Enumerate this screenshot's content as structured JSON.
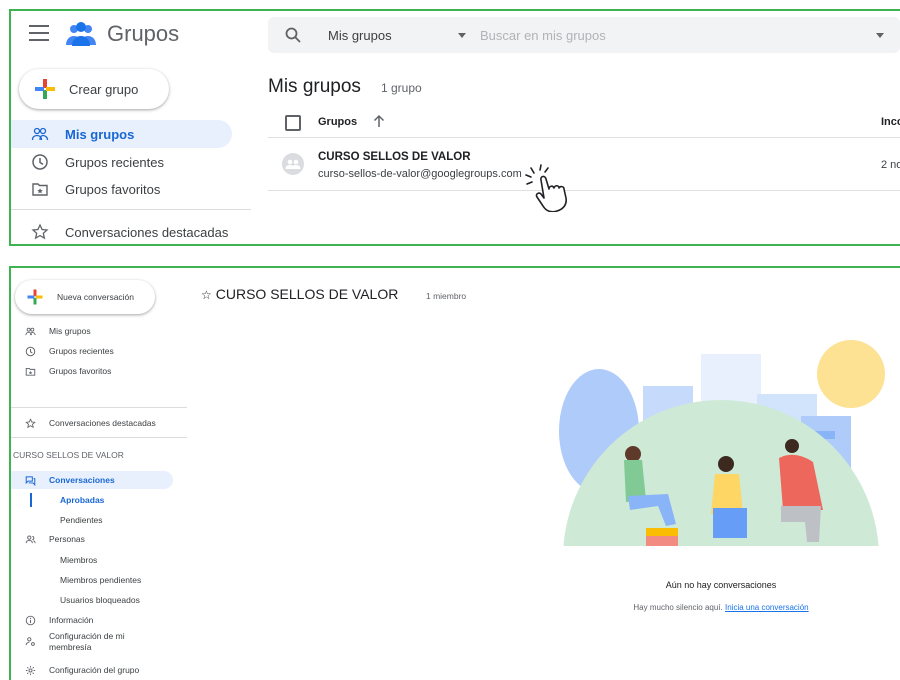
{
  "top": {
    "brand": "Grupos",
    "create_button": "Crear grupo",
    "nav": [
      {
        "label": "Mis grupos",
        "icon": "people-icon",
        "active": true
      },
      {
        "label": "Grupos recientes",
        "icon": "clock-icon"
      },
      {
        "label": "Grupos favoritos",
        "icon": "folder-star-icon"
      },
      {
        "label": "Conversaciones destacadas",
        "icon": "star-icon"
      }
    ],
    "search": {
      "scope": "Mis grupos",
      "placeholder": "Buscar en mis grupos"
    },
    "title": "Mis grupos",
    "count": "1 grupo",
    "table": {
      "col_groups": "Grupos",
      "col_right": "Inco",
      "rows": [
        {
          "name": "CURSO SELLOS DE VALOR",
          "email": "curso-sellos-de-valor@googlegroups.com",
          "right": "2 no"
        }
      ]
    }
  },
  "bottom": {
    "new_conversation": "Nueva conversación",
    "nav": [
      {
        "label": "Mis grupos"
      },
      {
        "label": "Grupos recientes"
      },
      {
        "label": "Grupos favoritos"
      },
      {
        "label": "Conversaciones destacadas"
      }
    ],
    "section": "CURSO SELLOS DE VALOR",
    "conversations": "Conversaciones",
    "approved": "Aprobadas",
    "pending": "Pendientes",
    "people": "Personas",
    "members": "Miembros",
    "pending_members": "Miembros pendientes",
    "blocked_users": "Usuarios bloqueados",
    "info": "Información",
    "membership_config": "Configuración de mi membresía",
    "group_config": "Configuración del grupo",
    "group_title": "CURSO SELLOS DE VALOR",
    "member_count": "1 miembro",
    "empty_title": "Aún no hay conversaciones",
    "empty_text": "Hay mucho silencio aquí.",
    "empty_link": "Inicia una conversación"
  },
  "colors": {
    "accent": "#1967d2",
    "active_bg": "#e8f0fe",
    "frame": "#3fb34f"
  }
}
